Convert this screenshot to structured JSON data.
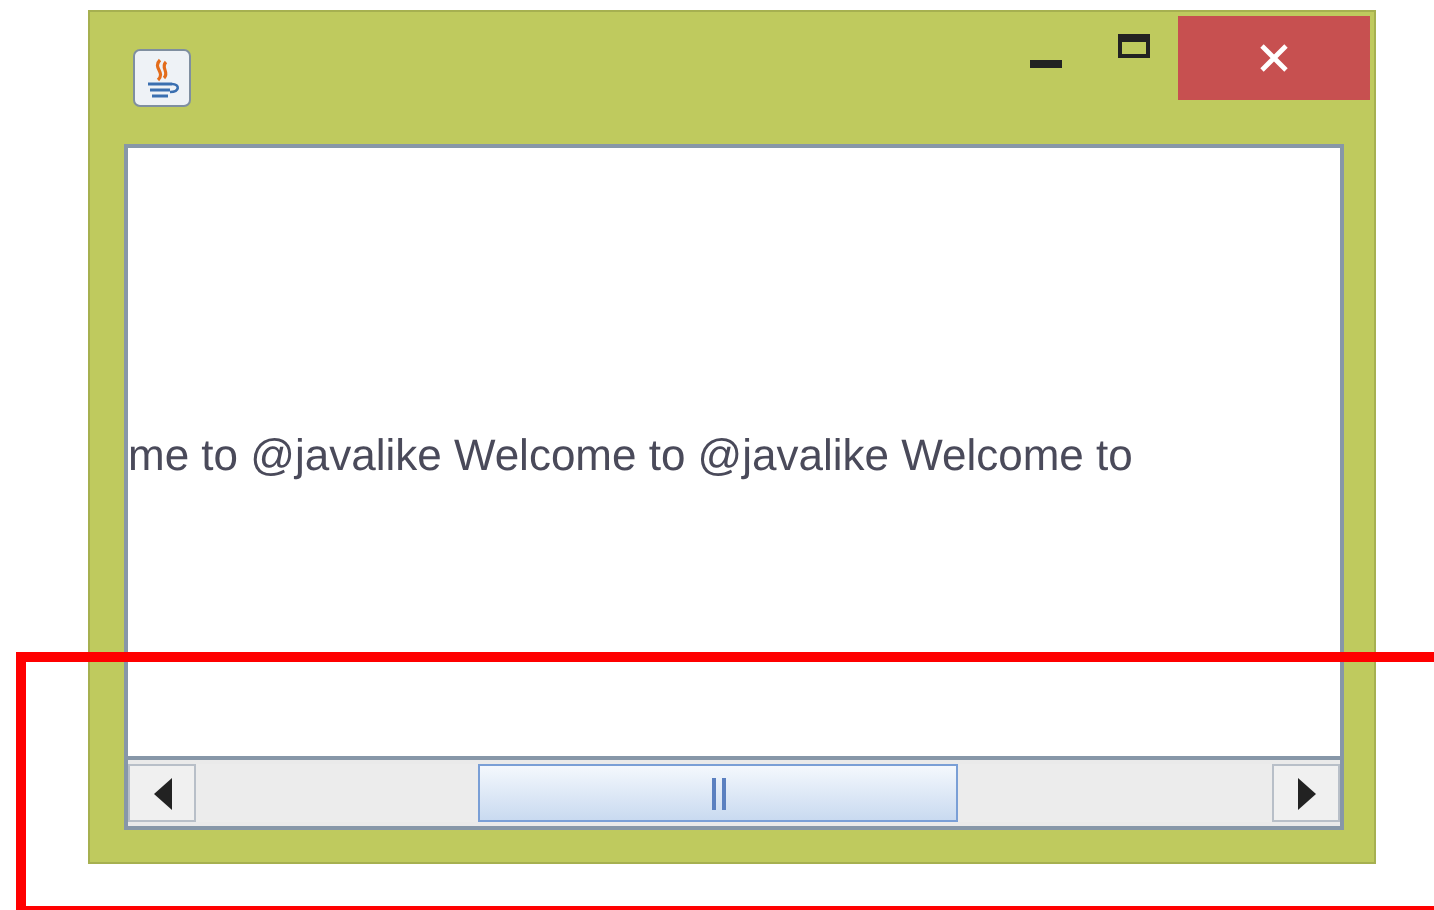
{
  "window": {
    "label": {
      "text": "me to @javalike Welcome to @javalike Welcome to"
    }
  }
}
